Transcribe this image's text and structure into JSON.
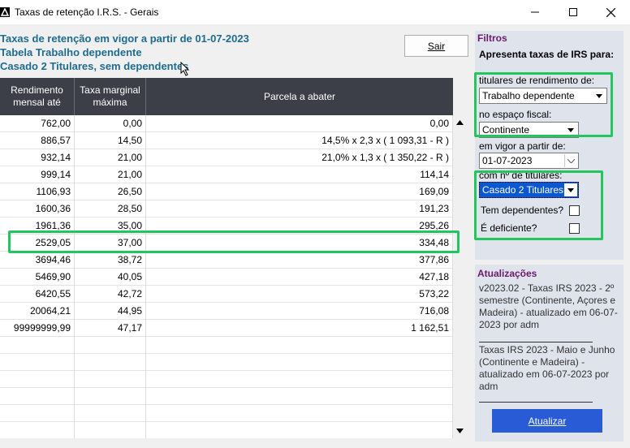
{
  "window": {
    "title": "Taxas de retenção I.R.S. - Gerais"
  },
  "heading": {
    "line1": "Taxas de retenção em vigor a partir de 01-07-2023",
    "line2": "Tabela Trabalho dependente",
    "line3": "Casado 2 Titulares, sem dependentes"
  },
  "toolbar": {
    "sair_label": "Sair"
  },
  "table": {
    "headers": {
      "col1": "Rendimento mensal até",
      "col2": "Taxa marginal máxima",
      "col3": "Parcela a abater"
    },
    "rows": [
      [
        "762,00",
        "0,00",
        "0,00"
      ],
      [
        "886,57",
        "14,50",
        "14,5% x 2,3 x ( 1 093,31 - R )"
      ],
      [
        "932,14",
        "21,00",
        "21,0% x 1,3 x ( 1 350,22 - R )"
      ],
      [
        "999,14",
        "21,00",
        "114,14"
      ],
      [
        "1106,93",
        "26,50",
        "169,09"
      ],
      [
        "1600,36",
        "28,50",
        "191,23"
      ],
      [
        "1961,36",
        "35,00",
        "295,26"
      ],
      [
        "2529,05",
        "37,00",
        "334,48"
      ],
      [
        "3694,46",
        "38,72",
        "377,86"
      ],
      [
        "5469,90",
        "40,05",
        "427,18"
      ],
      [
        "6420,55",
        "42,72",
        "573,22"
      ],
      [
        "20064,21",
        "44,95",
        "716,08"
      ],
      [
        "99999999,99",
        "47,17",
        "1 162,51"
      ]
    ],
    "highlighted_row": 7,
    "empty_rows": 6
  },
  "filters": {
    "title": "Filtros",
    "subtitle": "Apresenta taxas de IRS para:",
    "titulares_label": "titulares de rendimento de:",
    "titulares_value": "Trabalho dependente",
    "espaco_label": "no espaço fiscal:",
    "espaco_value": "Continente",
    "vigor_label": "em vigor a partir de:",
    "vigor_value": "01-07-2023",
    "num_titulares_label": "com nº de titulares:",
    "num_titulares_value": "Casado 2 Titulares",
    "dependentes_label": "Tem dependentes?",
    "dependentes_checked": false,
    "deficiente_label": "É deficiente?",
    "deficiente_checked": false
  },
  "updates": {
    "title": "Atualizações",
    "entry1": "v2023.02 - Taxas IRS 2023 - 2º semestre (Continente, Açores e Madeira) - atualizado em 06-07-2023 por adm",
    "entry2": "Taxas IRS 2023 - Maio e Junho (Continente e Madeira) - atualizado em 06-07-2023 por adm",
    "button_label": "Atualizar"
  },
  "colors": {
    "heading": "#1f6b8f",
    "header_bg": "#3c3f48",
    "highlight": "#22c55e",
    "panel_bg": "#dfe3ec",
    "panel_title": "#6b1a6b",
    "button_blue": "#2a5bd7"
  }
}
